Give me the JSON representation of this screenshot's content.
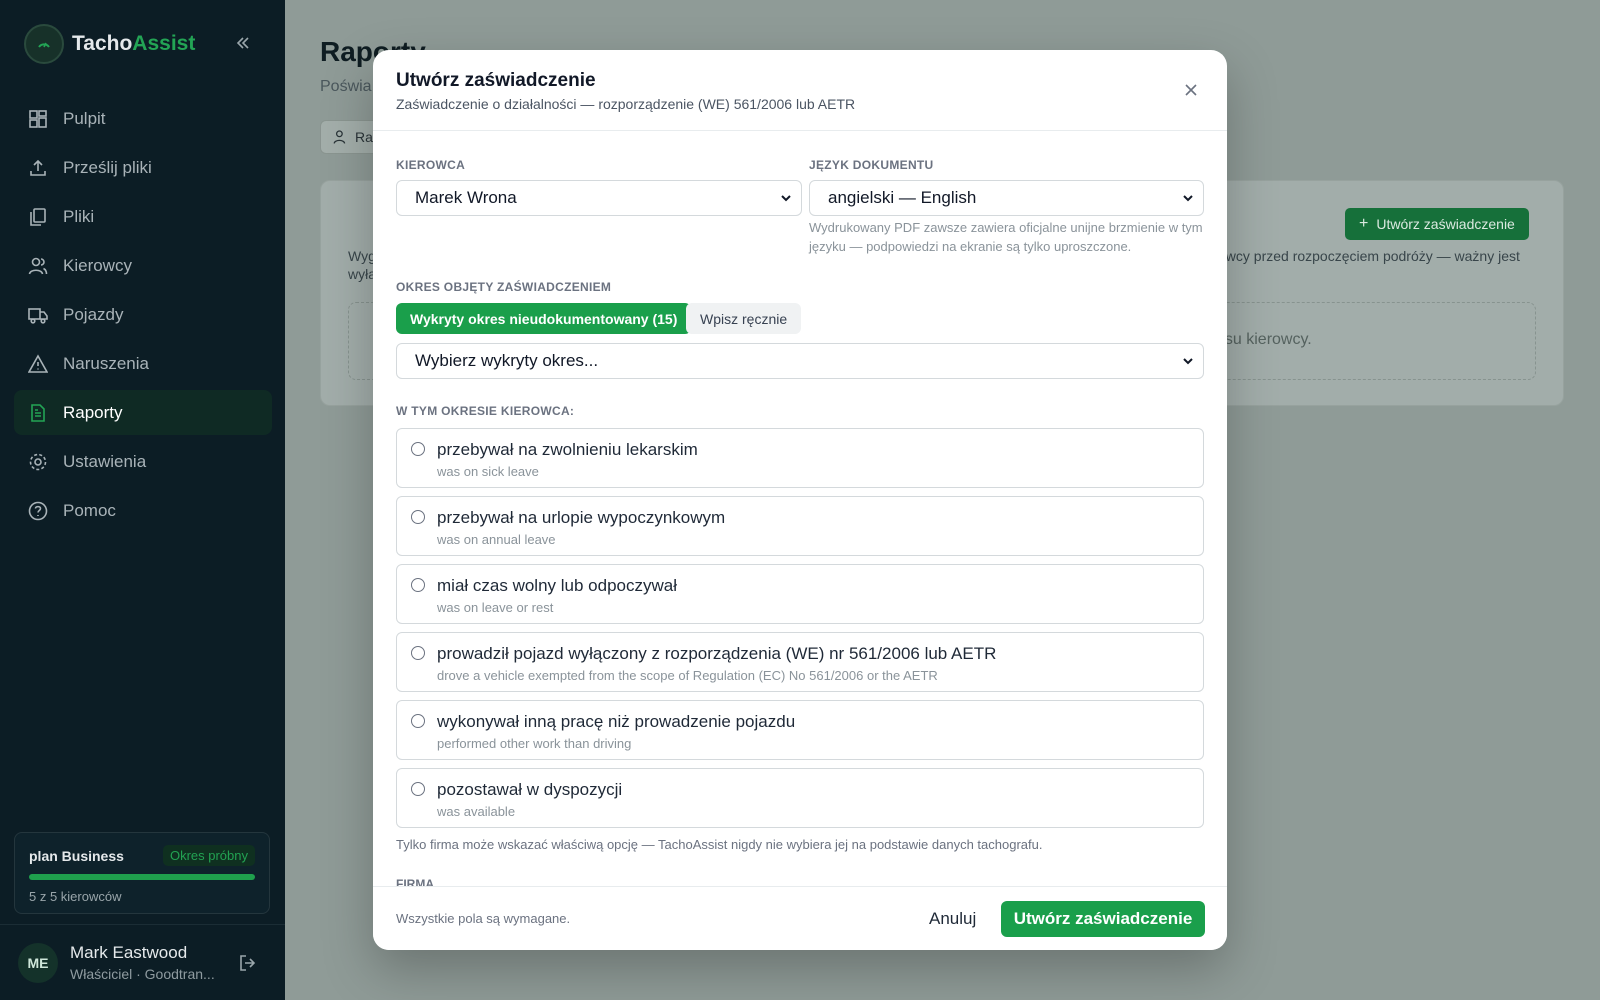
{
  "app": {
    "name_part1": "Tacho",
    "name_part2": "Assist"
  },
  "sidebar": {
    "items": [
      {
        "label": "Pulpit",
        "icon": "dashboard-icon"
      },
      {
        "label": "Prześlij pliki",
        "icon": "upload-icon"
      },
      {
        "label": "Pliki",
        "icon": "files-icon"
      },
      {
        "label": "Kierowcy",
        "icon": "users-icon"
      },
      {
        "label": "Pojazdy",
        "icon": "truck-icon"
      },
      {
        "label": "Naruszenia",
        "icon": "warning-icon"
      },
      {
        "label": "Raporty",
        "icon": "report-icon",
        "active": true
      },
      {
        "label": "Ustawienia",
        "icon": "gear-icon"
      },
      {
        "label": "Pomoc",
        "icon": "help-icon"
      }
    ],
    "plan": {
      "name": "plan Business",
      "badge": "Okres próbny",
      "count": "5 z 5 kierowców",
      "progress": 1.0
    },
    "user": {
      "initials": "ME",
      "name": "Mark Eastwood",
      "role": "Właściciel · Goodtran..."
    }
  },
  "background": {
    "title": "Raporty",
    "subtitle": "Poświa",
    "tab": "Ra",
    "create_button": "Utwórz zaświadczenie",
    "text_fragment": "owcy przed rozpoczęciem podróży — ważny jest",
    "text_left1": "Wyg",
    "text_left2": "wyła",
    "empty_fragment": "asu kierowcy."
  },
  "modal": {
    "title": "Utwórz zaświadczenie",
    "subtitle": "Zaświadczenie o działalności — rozporządzenie (WE) 561/2006 lub AETR",
    "driver_label": "KIEROWCA",
    "driver_value": "Marek Wrona",
    "language_label": "JĘZYK DOKUMENTU",
    "language_value": "angielski — English",
    "language_hint_line1": "Wydrukowany PDF zawsze zawiera oficjalne unijne brzmienie w tym",
    "language_hint_line2": "języku — podpowiedzi na ekranie są tylko uproszczone.",
    "period_label": "OKRES OBJĘTY ZAŚWIADCZENIEM",
    "period_tab_detected": "Wykryty okres nieudokumentowany (15)",
    "period_tab_manual": "Wpisz ręcznie",
    "period_select": "Wybierz wykryty okres...",
    "reason_label": "W TYM OKRESIE KIEROWCA:",
    "options": [
      {
        "pl": "przebywał na zwolnieniu lekarskim",
        "en": "was on sick leave"
      },
      {
        "pl": "przebywał na urlopie wypoczynkowym",
        "en": "was on annual leave"
      },
      {
        "pl": "miał czas wolny lub odpoczywał",
        "en": "was on leave or rest"
      },
      {
        "pl": "prowadził pojazd wyłączony z rozporządzenia (WE) nr 561/2006 lub AETR",
        "en": "drove a vehicle exempted from the scope of Regulation (EC) No 561/2006 or the AETR"
      },
      {
        "pl": "wykonywał inną pracę niż prowadzenie pojazdu",
        "en": "performed other work than driving"
      },
      {
        "pl": "pozostawał w dyspozycji",
        "en": "was available"
      }
    ],
    "note": "Tylko firma może wskazać właściwą opcję — TachoAssist nigdy nie wybiera jej na podstawie danych tachografu.",
    "company_label": "FIRMA",
    "footer_note": "Wszystkie pola są wymagane.",
    "cancel": "Anuluj",
    "submit": "Utwórz zaświadczenie"
  },
  "colors": {
    "accent": "#1a9f4b",
    "sidebar_bg": "#0c1d25",
    "overlay": "#8f9b97"
  }
}
